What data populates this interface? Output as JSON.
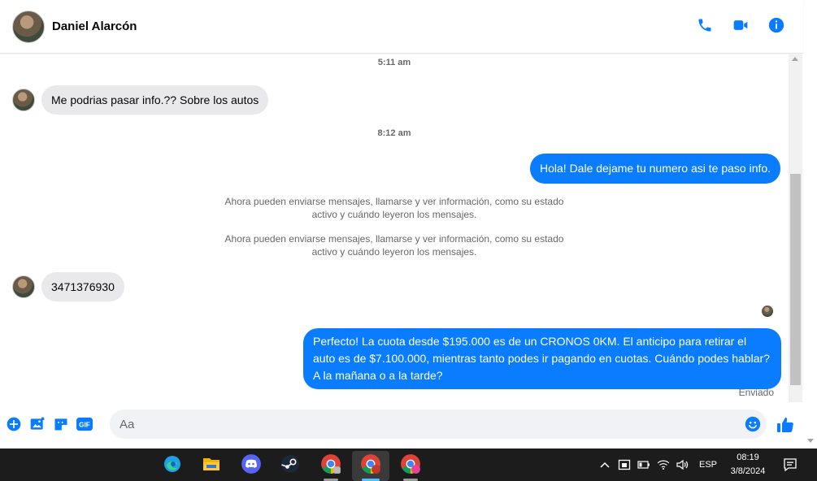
{
  "header": {
    "contact_name": "Daniel Alarcón",
    "icons": [
      "phone-icon",
      "video-camera-icon",
      "info-icon"
    ]
  },
  "messages": {
    "timestamp_1": "5:11 am",
    "incoming_1": "Me podrias pasar info.?? Sobre los autos",
    "timestamp_2": "8:12 am",
    "outgoing_1": "Hola! Dale dejame tu numero  asi te paso info.",
    "system_1": "Ahora pueden enviarse mensajes, llamarse y ver información, como su estado activo y cuándo leyeron los mensajes.",
    "system_2": "Ahora pueden enviarse mensajes, llamarse y ver información, como su estado activo y cuándo leyeron los mensajes.",
    "incoming_2": "3471376930",
    "outgoing_2": "Perfecto! La cuota desde $195.000 es de un CRONOS 0KM. El anticipo para retirar el auto es de $7.100.000, mientras tanto podes ir pagando en cuotas. Cuándo podes hablar? A la mañana o a la tarde?",
    "status": "Enviado"
  },
  "composer": {
    "placeholder": "Aa",
    "icons": [
      "plus-circle-icon",
      "image-icon",
      "sticker-icon",
      "gif-icon",
      "emoji-icon",
      "thumbs-up-icon"
    ],
    "gif_label": "GIF"
  },
  "taskbar": {
    "apps": [
      "edge-icon",
      "file-explorer-icon",
      "discord-icon",
      "steam-icon",
      "chrome-icon",
      "chrome-icon",
      "chrome-icon"
    ],
    "language": "ESP",
    "time": "08:19",
    "date": "3/8/2024"
  },
  "colors": {
    "accent": "#0a7cff",
    "incoming_bubble": "#e9e9eb",
    "taskbar": "#1c1c1c"
  }
}
